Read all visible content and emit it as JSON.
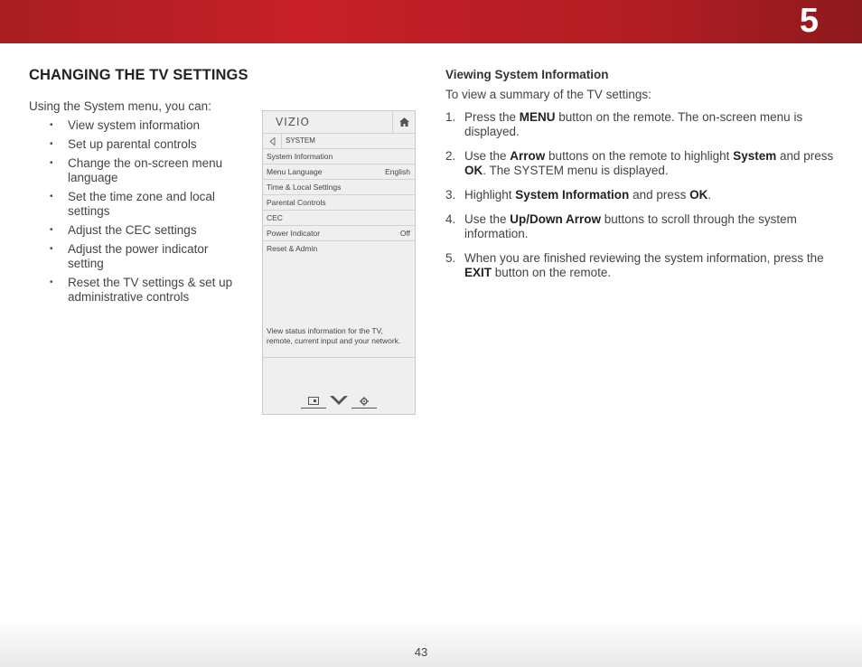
{
  "header": {
    "chapter_number": "5"
  },
  "left": {
    "section_title": "CHANGING THE TV SETTINGS",
    "intro": "Using the System menu, you can:",
    "bullets": [
      "View system information",
      "Set up parental controls",
      "Change the on-screen menu language",
      "Set the time zone and local settings",
      "Adjust the CEC settings",
      "Adjust the power indicator setting",
      "Reset the TV settings & set up administrative controls"
    ]
  },
  "tv_menu": {
    "logo": "VIZIO",
    "breadcrumb": "SYSTEM",
    "items": [
      {
        "label": "System Information",
        "value": ""
      },
      {
        "label": "Menu Language",
        "value": "English"
      },
      {
        "label": "Time & Local Settings",
        "value": ""
      },
      {
        "label": "Parental Controls",
        "value": ""
      },
      {
        "label": "CEC",
        "value": ""
      },
      {
        "label": "Power Indicator",
        "value": "Off"
      },
      {
        "label": "Reset & Admin",
        "value": ""
      }
    ],
    "description": "View status information for the TV, remote, current input and your network.",
    "icons": [
      "home-icon",
      "back-arrow-icon",
      "input-icon",
      "vizio-v-icon",
      "gear-icon"
    ]
  },
  "right": {
    "subsection_title": "Viewing System Information",
    "intro": "To view a summary of the TV settings:",
    "steps": [
      {
        "num": "1.",
        "parts": [
          "Press the ",
          "MENU",
          " button on the remote. The on-screen menu is displayed."
        ]
      },
      {
        "num": "2.",
        "parts": [
          "Use the ",
          "Arrow",
          " buttons on the remote to highlight ",
          "System",
          " and press ",
          "OK",
          ". The SYSTEM menu is displayed."
        ]
      },
      {
        "num": "3.",
        "parts": [
          "Highlight ",
          "System Information",
          " and press ",
          "OK",
          "."
        ]
      },
      {
        "num": "4.",
        "parts": [
          "Use the ",
          "Up/Down Arrow",
          " buttons to scroll through the system information."
        ]
      },
      {
        "num": "5.",
        "parts": [
          "When you are finished reviewing the system information, press the ",
          "EXIT",
          " button on the remote."
        ]
      }
    ]
  },
  "footer": {
    "page_number": "43"
  },
  "colors": {
    "header_red": "#c8202a",
    "text": "#444444"
  }
}
